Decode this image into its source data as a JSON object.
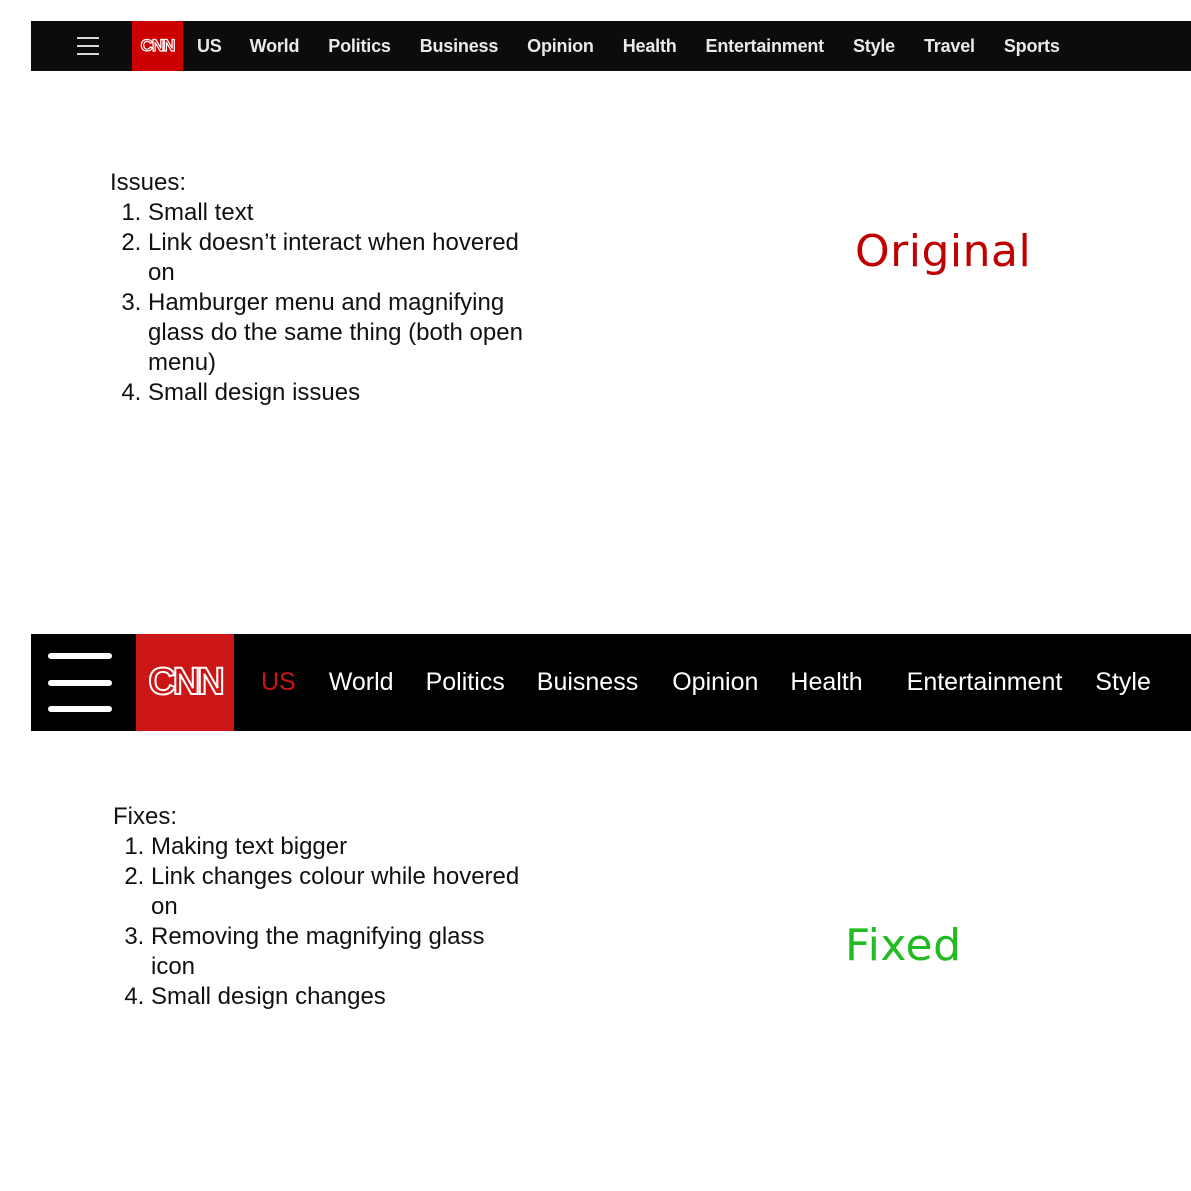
{
  "original": {
    "nav": {
      "logo_text": "CNN",
      "links": [
        "US",
        "World",
        "Politics",
        "Business",
        "Opinion",
        "Health",
        "Entertainment",
        "Style",
        "Travel",
        "Sports"
      ]
    },
    "heading": "Issues:",
    "items": [
      "Small text",
      "Link doesn’t interact when hovered on",
      "Hamburger menu and magnifying glass do the same thing (both open menu)",
      "Small design issues"
    ],
    "label": "Original",
    "label_color": "#c00000"
  },
  "fixed": {
    "nav": {
      "logo_text": "CNN",
      "links": [
        "US",
        "World",
        "Politics",
        "Buisness",
        "Opinion",
        "Health",
        "Entertainment",
        "Style"
      ],
      "active_link": "US",
      "active_color": "#cc1515"
    },
    "heading": "Fixes:",
    "items": [
      "Making text bigger",
      "Link changes colour while hovered on",
      "Removing the magnifying glass icon",
      "Small design changes"
    ],
    "label": "Fixed",
    "label_color": "#22bb22"
  }
}
